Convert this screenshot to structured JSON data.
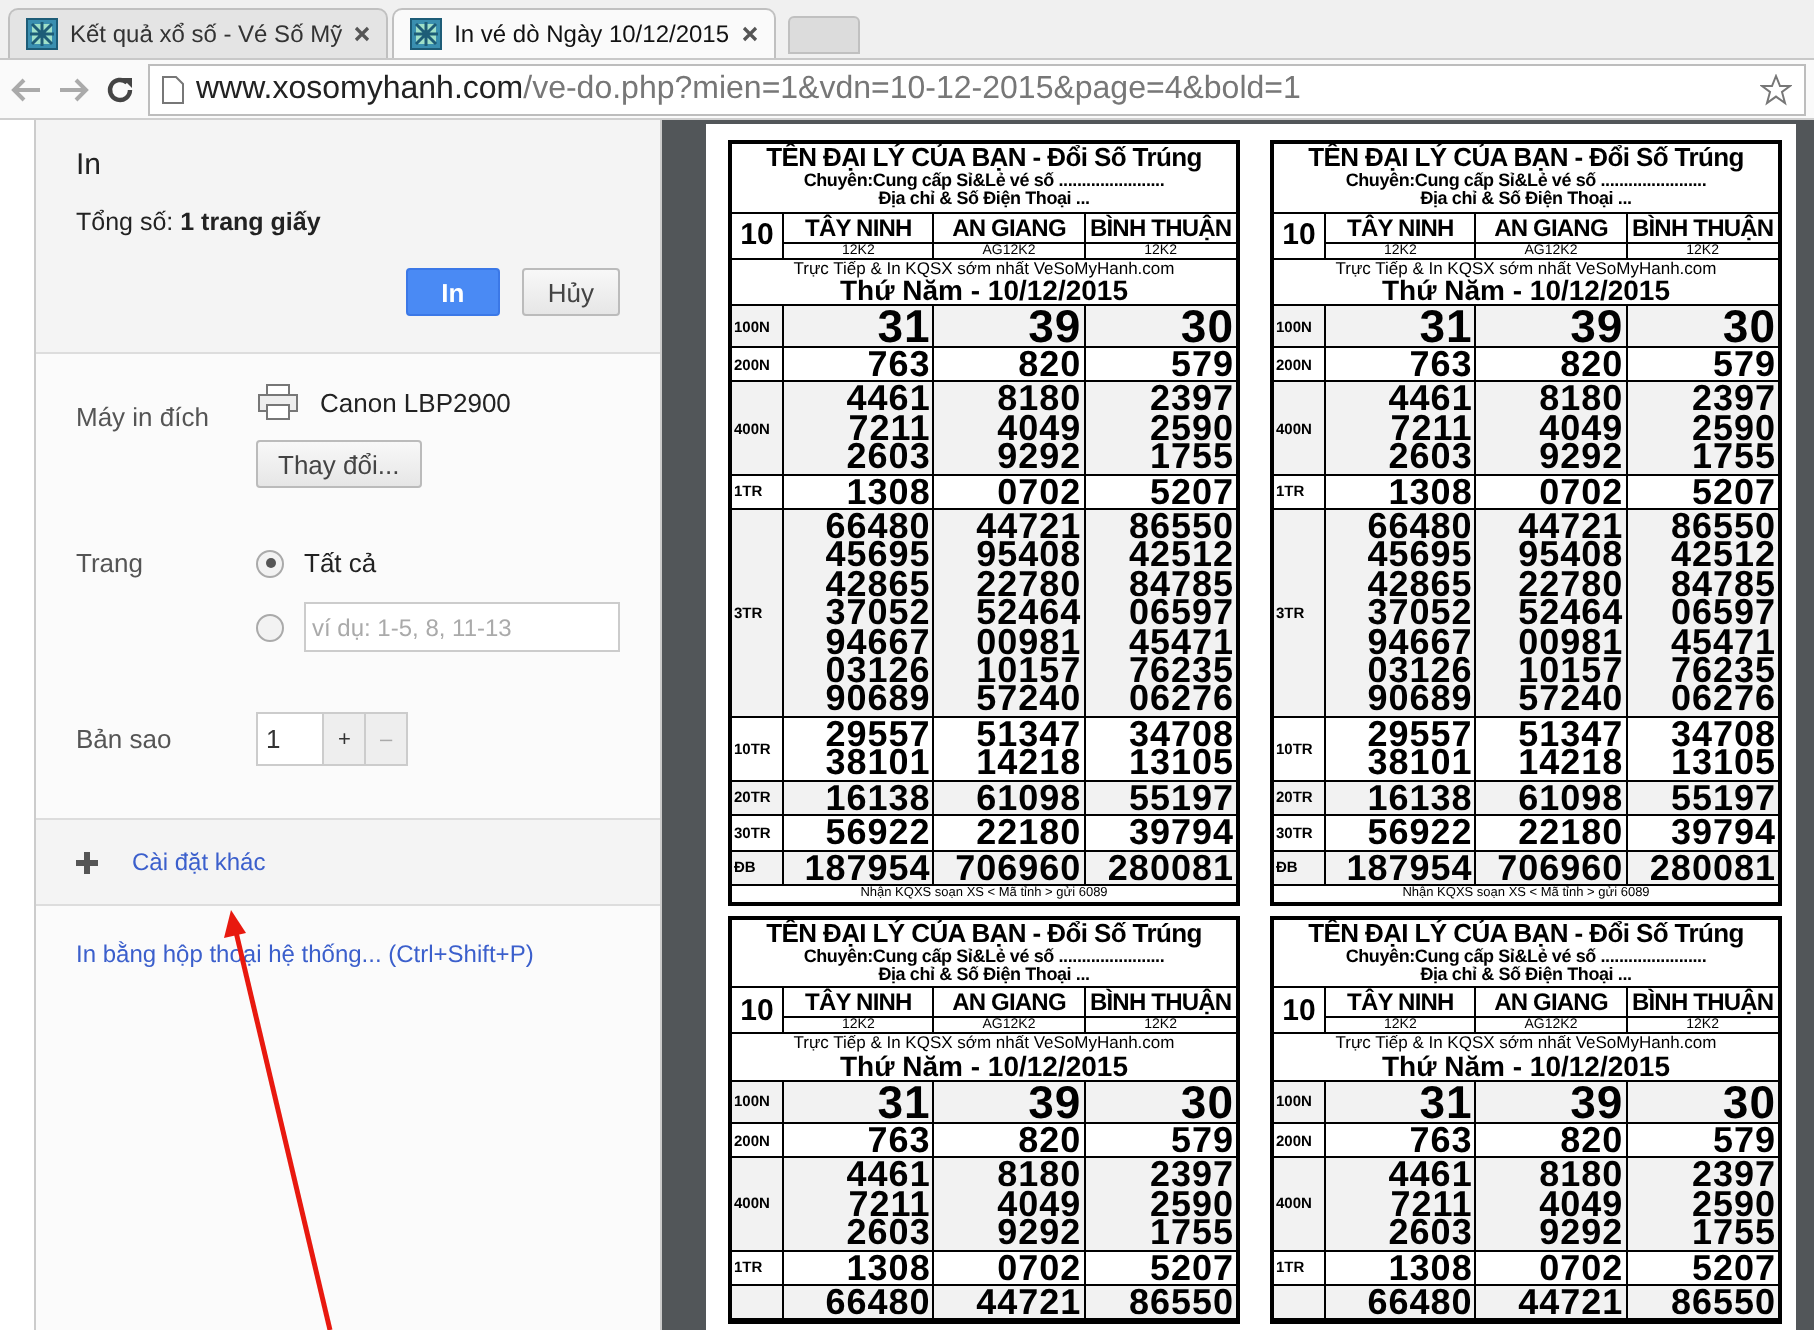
{
  "tabs": [
    {
      "title": "Kết quả xổ số - Vé Số Mỹ",
      "selected": false
    },
    {
      "title": "In vé dò Ngày 10/12/2015",
      "selected": true
    }
  ],
  "address_bar": {
    "host": "www.xosomyhanh.com",
    "path": "/ve-do.php?mien=1&vdn=10-12-2015&page=4&bold=1"
  },
  "print_panel": {
    "title": "In",
    "total": "Tổng số: **1 trang giấy**",
    "print_button": "In",
    "cancel_button": "Hủy",
    "destination": {
      "label": "Máy in đích",
      "printer": "Canon LBP2900",
      "change_button": "Thay đổi..."
    },
    "pages": {
      "label": "Trang",
      "options": [
        {
          "kind": "all",
          "label": "Tất cả",
          "selected": true
        },
        {
          "kind": "range",
          "placeholder": "ví dụ: 1-5, 8, 11-13",
          "selected": false
        }
      ]
    },
    "copies": {
      "label": "Bản sao",
      "value": "1",
      "plus": "+",
      "minus": "–"
    },
    "more_settings": "Cài đặt khác",
    "system_dialog_link": "In bằng hộp thoại hệ thống... (Ctrl+Shift+P)"
  },
  "tickets": [
    {
      "title": "TÊN ĐẠI LÝ CỦA BẠN - Đổi Số Trúng",
      "subtitle": "Chuyên:Cung cấp Sỉ&Lẻ vé số .......................",
      "address": "Địa chỉ & Số Điện Thoại ...",
      "draw_no": "10",
      "provinces": [
        {
          "name": "TÂY NINH",
          "code": "12K2"
        },
        {
          "name": "AN GIANG",
          "code": "AG12K2"
        },
        {
          "name": "BÌNH THUẬN",
          "code": "12K2"
        }
      ],
      "promo": "Trực Tiếp & In KQSX sớm nhất VeSoMyHanh.com",
      "date": "Thứ Năm - 10/12/2015",
      "prizes": [
        {
          "label": "100N",
          "values": [
            [
              "31"
            ],
            [
              "39"
            ],
            [
              "30"
            ]
          ]
        },
        {
          "label": "200N",
          "values": [
            [
              "763"
            ],
            [
              "820"
            ],
            [
              "579"
            ]
          ]
        },
        {
          "label": "400N",
          "values": [
            [
              "4461",
              "7211",
              "2603"
            ],
            [
              "8180",
              "4049",
              "9292"
            ],
            [
              "2397",
              "2590",
              "1755"
            ]
          ]
        },
        {
          "label": "1TR",
          "values": [
            [
              "1308"
            ],
            [
              "0702"
            ],
            [
              "5207"
            ]
          ]
        },
        {
          "label": "3TR",
          "values": [
            [
              "66480",
              "45695",
              "42865",
              "37052",
              "94667",
              "03126",
              "90689"
            ],
            [
              "44721",
              "95408",
              "22780",
              "52464",
              "00981",
              "10157",
              "57240"
            ],
            [
              "86550",
              "42512",
              "84785",
              "06597",
              "45471",
              "76235",
              "06276"
            ]
          ]
        },
        {
          "label": "10TR",
          "values": [
            [
              "29557",
              "38101"
            ],
            [
              "51347",
              "14218"
            ],
            [
              "34708",
              "13105"
            ]
          ]
        },
        {
          "label": "20TR",
          "values": [
            [
              "16138"
            ],
            [
              "61098"
            ],
            [
              "55197"
            ]
          ]
        },
        {
          "label": "30TR",
          "values": [
            [
              "56922"
            ],
            [
              "22180"
            ],
            [
              "39794"
            ]
          ]
        },
        {
          "label": "ĐB",
          "values": [
            [
              "187954"
            ],
            [
              "706960"
            ],
            [
              "280081"
            ]
          ]
        }
      ],
      "footer": "Nhận KQXS soạn XS < Mã tỉnh > gửi 6089"
    },
    {
      "title": "TÊN ĐẠI LÝ CỦA BẠN - Đổi Số Trúng",
      "subtitle": "Chuyên:Cung cấp Sỉ&Lẻ vé số .......................",
      "address": "Địa chỉ & Số Điện Thoại ...",
      "draw_no": "10",
      "provinces": [
        {
          "name": "TÂY NINH",
          "code": "12K2"
        },
        {
          "name": "AN GIANG",
          "code": "AG12K2"
        },
        {
          "name": "BÌNH THUẬN",
          "code": "12K2"
        }
      ],
      "promo": "Trực Tiếp & In KQSX sớm nhất VeSoMyHanh.com",
      "date": "Thứ Năm - 10/12/2015",
      "prizes": [
        {
          "label": "100N",
          "values": [
            [
              "31"
            ],
            [
              "39"
            ],
            [
              "30"
            ]
          ]
        },
        {
          "label": "200N",
          "values": [
            [
              "763"
            ],
            [
              "820"
            ],
            [
              "579"
            ]
          ]
        },
        {
          "label": "400N",
          "values": [
            [
              "4461",
              "7211",
              "2603"
            ],
            [
              "8180",
              "4049",
              "9292"
            ],
            [
              "2397",
              "2590",
              "1755"
            ]
          ]
        },
        {
          "label": "1TR",
          "values": [
            [
              "1308"
            ],
            [
              "0702"
            ],
            [
              "5207"
            ]
          ]
        },
        {
          "label": "3TR",
          "values": [
            [
              "66480",
              "45695",
              "42865",
              "37052",
              "94667",
              "03126",
              "90689"
            ],
            [
              "44721",
              "95408",
              "22780",
              "52464",
              "00981",
              "10157",
              "57240"
            ],
            [
              "86550",
              "42512",
              "84785",
              "06597",
              "45471",
              "76235",
              "06276"
            ]
          ]
        },
        {
          "label": "10TR",
          "values": [
            [
              "29557",
              "38101"
            ],
            [
              "51347",
              "14218"
            ],
            [
              "34708",
              "13105"
            ]
          ]
        },
        {
          "label": "20TR",
          "values": [
            [
              "16138"
            ],
            [
              "61098"
            ],
            [
              "55197"
            ]
          ]
        },
        {
          "label": "30TR",
          "values": [
            [
              "56922"
            ],
            [
              "22180"
            ],
            [
              "39794"
            ]
          ]
        },
        {
          "label": "ĐB",
          "values": [
            [
              "187954"
            ],
            [
              "706960"
            ],
            [
              "280081"
            ]
          ]
        }
      ],
      "footer": "Nhận KQXS soạn XS < Mã tỉnh > gửi 6089"
    },
    {
      "title": "TÊN ĐẠI LÝ CỦA BẠN - Đổi Số Trúng",
      "subtitle": "Chuyên:Cung cấp Sỉ&Lẻ vé số .......................",
      "address": "Địa chỉ & Số Điện Thoại ...",
      "draw_no": "10",
      "provinces": [
        {
          "name": "TÂY NINH",
          "code": "12K2"
        },
        {
          "name": "AN GIANG",
          "code": "AG12K2"
        },
        {
          "name": "BÌNH THUẬN",
          "code": "12K2"
        }
      ],
      "promo": "Trực Tiếp & In KQSX sớm nhất VeSoMyHanh.com",
      "date": "Thứ Năm - 10/12/2015",
      "prizes": [
        {
          "label": "100N",
          "values": [
            [
              "31"
            ],
            [
              "39"
            ],
            [
              "30"
            ]
          ]
        },
        {
          "label": "200N",
          "values": [
            [
              "763"
            ],
            [
              "820"
            ],
            [
              "579"
            ]
          ]
        },
        {
          "label": "400N",
          "values": [
            [
              "4461",
              "7211",
              "2603"
            ],
            [
              "8180",
              "4049",
              "9292"
            ],
            [
              "2397",
              "2590",
              "1755"
            ]
          ]
        },
        {
          "label": "1TR",
          "values": [
            [
              "1308"
            ],
            [
              "0702"
            ],
            [
              "5207"
            ]
          ]
        },
        {
          "values": [
            [
              "66480"
            ],
            [
              "44721"
            ],
            [
              "86550"
            ]
          ]
        }
      ]
    },
    {
      "title": "TÊN ĐẠI LÝ CỦA BẠN - Đổi Số Trúng",
      "subtitle": "Chuyên:Cung cấp Sỉ&Lẻ vé số .......................",
      "address": "Địa chỉ & Số Điện Thoại ...",
      "draw_no": "10",
      "provinces": [
        {
          "name": "TÂY NINH",
          "code": "12K2"
        },
        {
          "name": "AN GIANG",
          "code": "AG12K2"
        },
        {
          "name": "BÌNH THUẬN",
          "code": "12K2"
        }
      ],
      "promo": "Trực Tiếp & In KQSX sớm nhất VeSoMyHanh.com",
      "date": "Thứ Năm - 10/12/2015",
      "prizes": [
        {
          "label": "100N",
          "values": [
            [
              "31"
            ],
            [
              "39"
            ],
            [
              "30"
            ]
          ]
        },
        {
          "label": "200N",
          "values": [
            [
              "763"
            ],
            [
              "820"
            ],
            [
              "579"
            ]
          ]
        },
        {
          "label": "400N",
          "values": [
            [
              "4461",
              "7211",
              "2603"
            ],
            [
              "8180",
              "4049",
              "9292"
            ],
            [
              "2397",
              "2590",
              "1755"
            ]
          ]
        },
        {
          "label": "1TR",
          "values": [
            [
              "1308"
            ],
            [
              "0702"
            ],
            [
              "5207"
            ]
          ]
        },
        {
          "values": [
            [
              "66480"
            ],
            [
              "44721"
            ],
            [
              "86550"
            ]
          ]
        }
      ]
    }
  ]
}
